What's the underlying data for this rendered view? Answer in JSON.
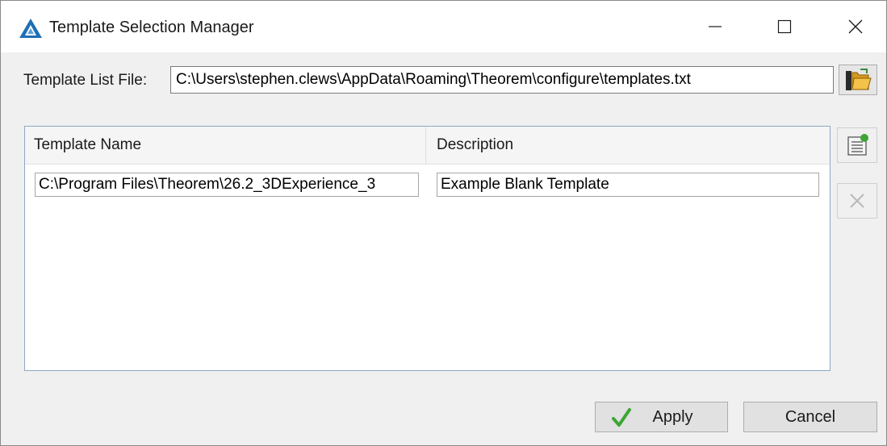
{
  "window": {
    "title": "Template Selection Manager",
    "controls": {
      "minimize": "minimize",
      "maximize": "maximize",
      "close": "close"
    }
  },
  "template_list_file": {
    "label": "Template List File:",
    "value": "C:\\Users\\stephen.clews\\AppData\\Roaming\\Theorem\\configure\\templates.txt",
    "browse_icon": "folder-open-icon"
  },
  "grid": {
    "columns": [
      "Template Name",
      "Description"
    ],
    "rows": [
      {
        "template_name": "C:\\Program Files\\Theorem\\26.2_3DExperience_3",
        "description": "Example Blank Template"
      }
    ]
  },
  "side_buttons": {
    "add_icon": "add-template-icon",
    "delete_icon": "delete-x-icon"
  },
  "footer": {
    "apply_label": "Apply",
    "cancel_label": "Cancel"
  },
  "colors": {
    "app_icon_blue": "#1f6fb5",
    "check_green": "#3fa535",
    "grid_border": "#8ea9c6"
  }
}
